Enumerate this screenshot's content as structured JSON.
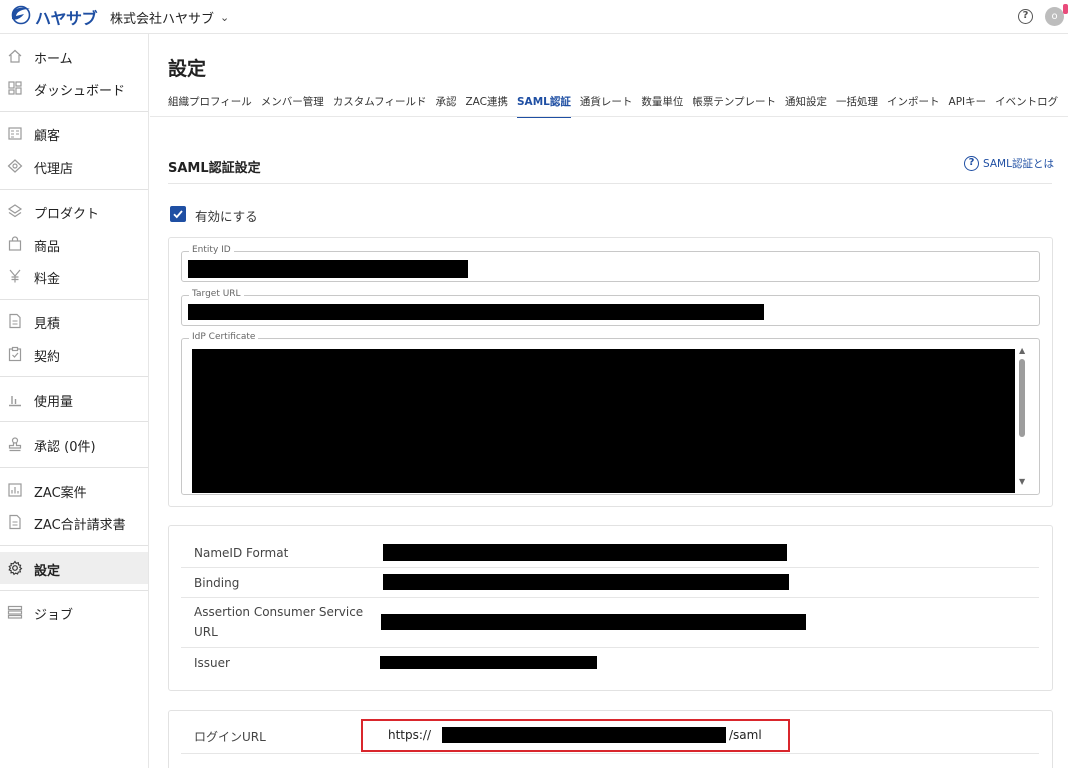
{
  "header": {
    "logo_text": "ハヤサブ",
    "company": "株式会社ハヤサブ",
    "help_glyph": "?",
    "avatar_initial": "o"
  },
  "sidebar": {
    "items": [
      {
        "label": "ホーム",
        "icon": "home-icon"
      },
      {
        "label": "ダッシュボード",
        "icon": "dashboard-icon"
      },
      {
        "label": "顧客",
        "icon": "customer-icon"
      },
      {
        "label": "代理店",
        "icon": "agency-icon"
      },
      {
        "label": "プロダクト",
        "icon": "layers-icon"
      },
      {
        "label": "商品",
        "icon": "bag-icon"
      },
      {
        "label": "料金",
        "icon": "yen-icon"
      },
      {
        "label": "見積",
        "icon": "document-icon"
      },
      {
        "label": "契約",
        "icon": "clipboard-icon"
      },
      {
        "label": "使用量",
        "icon": "bar-chart-icon"
      },
      {
        "label": "承認 (0件)",
        "icon": "stamp-icon"
      },
      {
        "label": "ZAC案件",
        "icon": "chart-box-icon"
      },
      {
        "label": "ZAC合計請求書",
        "icon": "invoice-icon"
      },
      {
        "label": "設定",
        "icon": "gear-icon"
      },
      {
        "label": "ジョブ",
        "icon": "list-icon"
      }
    ]
  },
  "main": {
    "title": "設定",
    "tabs": [
      "組織プロフィール",
      "メンバー管理",
      "カスタムフィールド",
      "承認",
      "ZAC連携",
      "SAML認証",
      "通貨レート",
      "数量単位",
      "帳票テンプレート",
      "通知設定",
      "一括処理",
      "インポート",
      "APIキー",
      "イベントログ"
    ],
    "active_tab": "SAML認証",
    "section_title": "SAML認証設定",
    "help_link": "SAML認証とは",
    "enable_label": "有効にする",
    "enabled": true,
    "fields": {
      "entity_id_label": "Entity ID",
      "target_url_label": "Target URL",
      "idp_certificate_label": "IdP Certificate"
    },
    "sp_info": {
      "nameid_label": "NameID Format",
      "binding_label": "Binding",
      "acs_label": "Assertion Consumer Service URL",
      "issuer_label": "Issuer"
    },
    "login": {
      "label": "ログインURL",
      "prefix": "https://",
      "suffix": "/saml"
    },
    "colors": {
      "accent": "#1f4fa3",
      "highlight": "#d9262c"
    }
  }
}
